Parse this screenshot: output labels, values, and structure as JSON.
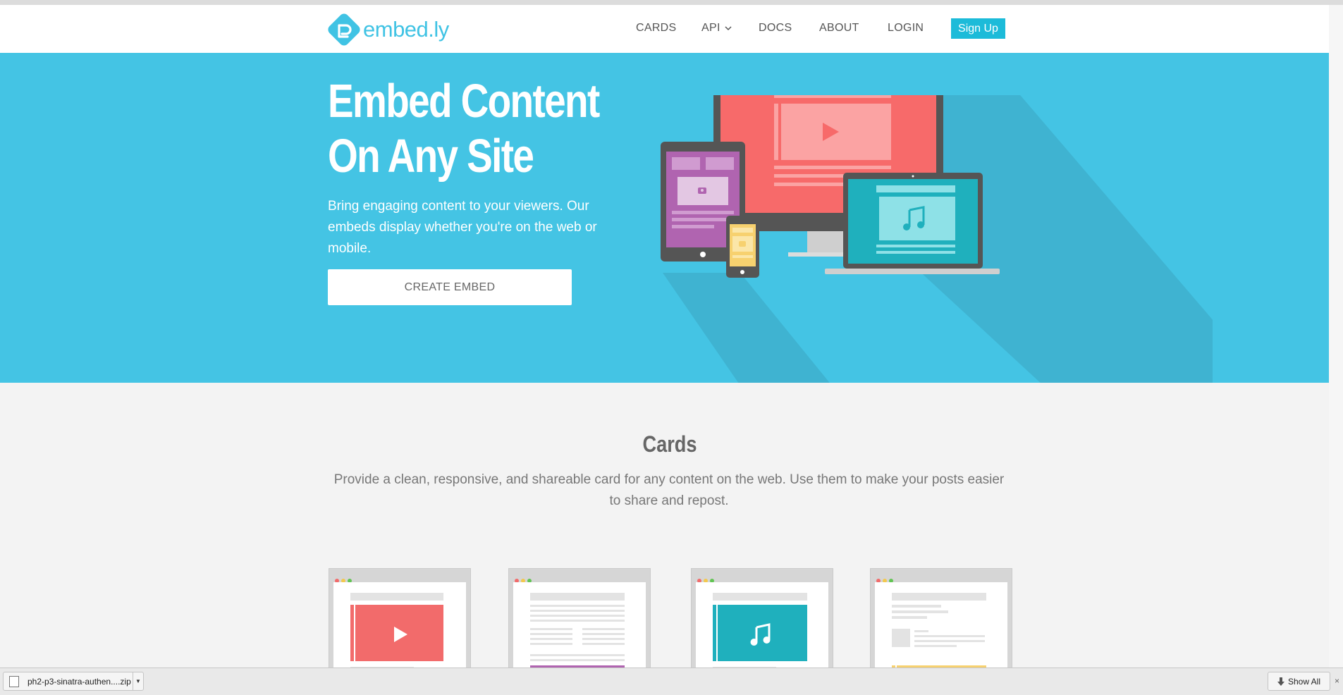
{
  "header": {
    "logo_text": "embed.ly",
    "nav": {
      "cards": "CARDS",
      "api": "API",
      "docs": "DOCS",
      "about": "ABOUT",
      "login": "LOGIN"
    },
    "signup_label": "Sign Up"
  },
  "hero": {
    "title_line1": "Embed Content",
    "title_line2": "On Any Site",
    "subtitle": "Bring engaging content to your viewers. Our embeds display whether you're on the web or mobile.",
    "cta_label": "CREATE EMBED"
  },
  "cards_section": {
    "title": "Cards",
    "description": "Provide a clean, responsive, and shareable card for any content on the web. Use them to make your posts easier to share and repost."
  },
  "download_bar": {
    "file_name": "ph2-p3-sinatra-authen....zip",
    "show_all_label": "Show All",
    "close_glyph": "×"
  },
  "colors": {
    "brand": "#40c3e4",
    "hero_bg": "#44c4e4",
    "signup_bg": "#1cbbd9",
    "video_red": "#f26b6b",
    "music_teal": "#1fb0bd",
    "photo_purple": "#b064b0",
    "photo_yellow": "#f7d16f"
  }
}
